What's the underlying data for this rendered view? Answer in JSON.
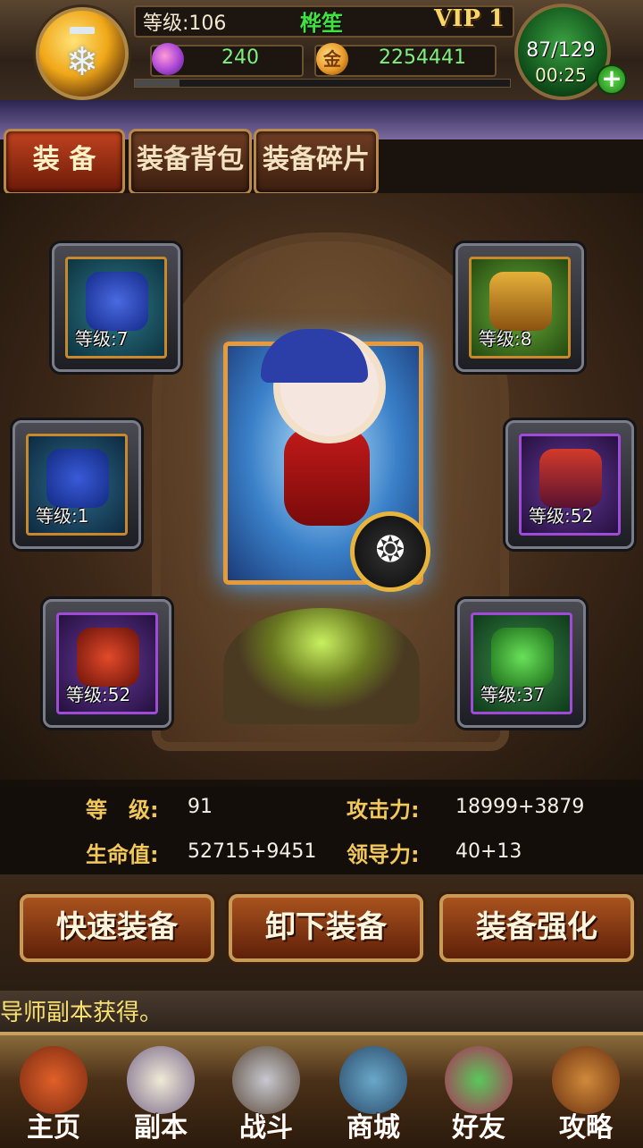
{
  "header": {
    "level_text": "等级:106",
    "player_name": "桦笙",
    "vip": "VIP 1",
    "gems": "240",
    "gold": "2254441",
    "gold_symbol": "金",
    "energy": "87/129",
    "energy_timer": "00:25",
    "plus": "+",
    "xp_fraction": 0.12
  },
  "tabs": [
    "装 备",
    "装备背包",
    "装备碎片"
  ],
  "equipment": [
    {
      "level": "等级:7",
      "icon": "helmet-icon"
    },
    {
      "level": "等级:8",
      "icon": "amulet-icon"
    },
    {
      "level": "等级:1",
      "icon": "armor-icon"
    },
    {
      "level": "等级:52",
      "icon": "cape-icon"
    },
    {
      "level": "等级:52",
      "icon": "boots-icon"
    },
    {
      "level": "等级:37",
      "icon": "ring-icon"
    }
  ],
  "hero": {
    "badge_icon": "wing-badge-icon",
    "badge_glyph": "❂"
  },
  "stats": {
    "level_label": "等　级:",
    "level_value": "91",
    "attack_label": "攻击力:",
    "attack_value": "18999+3879",
    "hp_label": "生命值:",
    "hp_value": "52715+9451",
    "leadership_label": "领导力:",
    "leadership_value": "40+13"
  },
  "actions": [
    "快速装备",
    "卸下装备",
    "装备强化"
  ],
  "notice": "导师副本获得。",
  "nav": [
    "主页",
    "副本",
    "战斗",
    "商城",
    "好友",
    "攻略"
  ]
}
